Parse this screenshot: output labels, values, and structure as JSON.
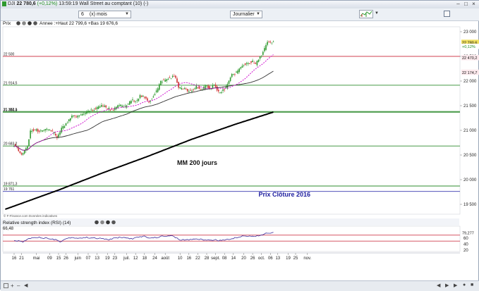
{
  "window": {
    "instrument": "DJI",
    "last_value": "22 780,6",
    "change": "(+0,12%)",
    "time": "13:59:19",
    "description": "Wall Street au comptant (10) (-)"
  },
  "toolbar": {
    "period_value": "6",
    "period_unit": "(x) mois",
    "interval": "Journalier"
  },
  "legend": {
    "series": "Prix",
    "period_info": "Annee :+Haut 22 799,6 +Bas 19 676,6"
  },
  "footer": {
    "copyright": "© F-Finance.com Données indicatives"
  },
  "colors": {
    "candle_up": "#2f9a2f",
    "candle_down": "#d03030",
    "ma_short": "#cc00cc",
    "ma_medium": "#333333",
    "ma_200": "#000000",
    "support": "#2e8b2e",
    "resistance": "#d04050",
    "prix_cloture_line": "#3a3ab0",
    "annotation_blue": "#2020a0",
    "rsi_line": "#3a2a9a",
    "last_price_tag": "#f0e060"
  },
  "chart_data": [
    {
      "type": "line",
      "title": "",
      "ylim": [
        19300,
        23100
      ],
      "y_ticks": [
        19500,
        20000,
        20500,
        21000,
        21500,
        22000,
        22500,
        23000
      ],
      "y_tick_labels": [
        "19 500",
        "20 000",
        "20 500",
        "21 000",
        "21 500",
        "22 000",
        "22 500",
        "23 000"
      ],
      "x_ticks": [
        {
          "day": 0,
          "label": "16"
        },
        {
          "day": 5,
          "label": "21"
        },
        {
          "day": 15,
          "label": "mai"
        },
        {
          "day": 24,
          "label": "09"
        },
        {
          "day": 30,
          "label": "15"
        },
        {
          "day": 35,
          "label": "26"
        },
        {
          "day": 43,
          "label": "juin"
        },
        {
          "day": 50,
          "label": "07"
        },
        {
          "day": 56,
          "label": "13"
        },
        {
          "day": 63,
          "label": "19"
        },
        {
          "day": 68,
          "label": "23"
        },
        {
          "day": 76,
          "label": "juil."
        },
        {
          "day": 82,
          "label": "12"
        },
        {
          "day": 88,
          "label": "18"
        },
        {
          "day": 95,
          "label": "24"
        },
        {
          "day": 102,
          "label": "août"
        },
        {
          "day": 112,
          "label": "10"
        },
        {
          "day": 118,
          "label": "16"
        },
        {
          "day": 124,
          "label": "22"
        },
        {
          "day": 130,
          "label": "28"
        },
        {
          "day": 136,
          "label": "sept."
        },
        {
          "day": 142,
          "label": "08"
        },
        {
          "day": 148,
          "label": "14"
        },
        {
          "day": 155,
          "label": "20"
        },
        {
          "day": 161,
          "label": "26"
        },
        {
          "day": 167,
          "label": "oct."
        },
        {
          "day": 173,
          "label": "06"
        },
        {
          "day": 178,
          "label": "13"
        },
        {
          "day": 185,
          "label": "19"
        },
        {
          "day": 190,
          "label": "25"
        },
        {
          "day": 198,
          "label": "nov."
        }
      ],
      "price_key": [
        [
          0,
          20700
        ],
        [
          2,
          20690
        ],
        [
          4,
          20580
        ],
        [
          6,
          20500
        ],
        [
          8,
          20600
        ],
        [
          10,
          20650
        ],
        [
          12,
          20990
        ],
        [
          16,
          21000
        ],
        [
          20,
          20980
        ],
        [
          24,
          21030
        ],
        [
          28,
          20950
        ],
        [
          30,
          20830
        ],
        [
          33,
          21040
        ],
        [
          36,
          21120
        ],
        [
          40,
          21280
        ],
        [
          44,
          21280
        ],
        [
          48,
          21350
        ],
        [
          52,
          21400
        ],
        [
          56,
          21430
        ],
        [
          60,
          21520
        ],
        [
          64,
          21450
        ],
        [
          68,
          21420
        ],
        [
          72,
          21510
        ],
        [
          76,
          21480
        ],
        [
          80,
          21600
        ],
        [
          84,
          21620
        ],
        [
          86,
          21700
        ],
        [
          88,
          21680
        ],
        [
          92,
          21580
        ],
        [
          94,
          21650
        ],
        [
          98,
          21850
        ],
        [
          100,
          21990
        ],
        [
          104,
          22030
        ],
        [
          108,
          22090
        ],
        [
          110,
          22070
        ],
        [
          112,
          21880
        ],
        [
          114,
          21840
        ],
        [
          116,
          21850
        ],
        [
          118,
          21780
        ],
        [
          122,
          21820
        ],
        [
          124,
          21900
        ],
        [
          128,
          21810
        ],
        [
          130,
          21900
        ],
        [
          134,
          21860
        ],
        [
          136,
          21950
        ],
        [
          138,
          21800
        ],
        [
          140,
          21760
        ],
        [
          142,
          21810
        ],
        [
          144,
          21870
        ],
        [
          146,
          21980
        ],
        [
          148,
          22130
        ],
        [
          150,
          22150
        ],
        [
          154,
          22270
        ],
        [
          156,
          22330
        ],
        [
          158,
          22360
        ],
        [
          162,
          22390
        ],
        [
          164,
          22340
        ],
        [
          166,
          22440
        ],
        [
          168,
          22530
        ],
        [
          170,
          22660
        ],
        [
          172,
          22780
        ],
        [
          174,
          22775
        ],
        [
          175,
          22780
        ]
      ],
      "series": [
        {
          "name": "MM 200 jours",
          "points": [
            [
              -6,
              19400
            ],
            [
              30,
              19790
            ],
            [
              60,
              20140
            ],
            [
              90,
              20470
            ],
            [
              120,
              20820
            ],
            [
              150,
              21130
            ],
            [
              175,
              21370
            ]
          ]
        }
      ],
      "support_lines": [
        {
          "value": 22500,
          "label": "22 500",
          "color": "red"
        },
        {
          "value": 21914.5,
          "label": "21 914,5",
          "color": "green"
        },
        {
          "value": 21382.1,
          "label": "21 382,1",
          "color": "green"
        },
        {
          "value": 21366.9,
          "label": "21 366,9",
          "color": "green"
        },
        {
          "value": 20683.2,
          "label": "20 683,2",
          "color": "green"
        },
        {
          "value": 19871.3,
          "label": "19 871,3",
          "color": "green"
        },
        {
          "value": 19761,
          "label": "19 761",
          "color": "blue"
        }
      ],
      "price_tags": [
        {
          "value": 22780.6,
          "label": "22 780,6"
        },
        {
          "value": 22700,
          "label": "+0,12%"
        },
        {
          "value": 22470.2,
          "label": "22 470,2"
        },
        {
          "value": 22174.7,
          "label": "22 174,7"
        }
      ],
      "annotations": [
        {
          "text": "MM 200 jours",
          "day": 110,
          "value": 20300
        },
        {
          "text": "Prix Clôture 2016",
          "day": 165,
          "value": 19660
        }
      ]
    },
    {
      "type": "line",
      "title": "Relative strength index (RSI) (14)",
      "series_value_label": "66,48",
      "ylim": [
        15,
        100
      ],
      "y_ticks": [
        20,
        40,
        60
      ],
      "y_tick_labels": [
        "20",
        "40",
        "60"
      ],
      "levels": [
        70,
        50
      ],
      "last_value": "79,277",
      "rsi_key": [
        [
          0,
          52
        ],
        [
          3,
          50
        ],
        [
          6,
          48
        ],
        [
          9,
          56
        ],
        [
          12,
          62
        ],
        [
          16,
          63
        ],
        [
          20,
          60
        ],
        [
          24,
          59
        ],
        [
          28,
          55
        ],
        [
          31,
          47
        ],
        [
          34,
          56
        ],
        [
          38,
          62
        ],
        [
          44,
          60
        ],
        [
          50,
          62
        ],
        [
          56,
          59
        ],
        [
          60,
          58
        ],
        [
          64,
          55
        ],
        [
          68,
          60
        ],
        [
          72,
          63
        ],
        [
          76,
          60
        ],
        [
          80,
          58
        ],
        [
          84,
          63
        ],
        [
          88,
          66
        ],
        [
          92,
          60
        ],
        [
          96,
          62
        ],
        [
          100,
          66
        ],
        [
          104,
          68
        ],
        [
          108,
          66
        ],
        [
          112,
          52
        ],
        [
          114,
          54
        ],
        [
          118,
          54
        ],
        [
          122,
          58
        ],
        [
          124,
          57
        ],
        [
          128,
          55
        ],
        [
          130,
          54
        ],
        [
          134,
          52
        ],
        [
          136,
          55
        ],
        [
          138,
          52
        ],
        [
          140,
          53
        ],
        [
          144,
          55
        ],
        [
          148,
          60
        ],
        [
          152,
          65
        ],
        [
          156,
          69
        ],
        [
          160,
          65
        ],
        [
          164,
          68
        ],
        [
          168,
          72
        ],
        [
          171,
          77
        ],
        [
          173,
          76
        ],
        [
          175,
          78
        ]
      ]
    }
  ]
}
